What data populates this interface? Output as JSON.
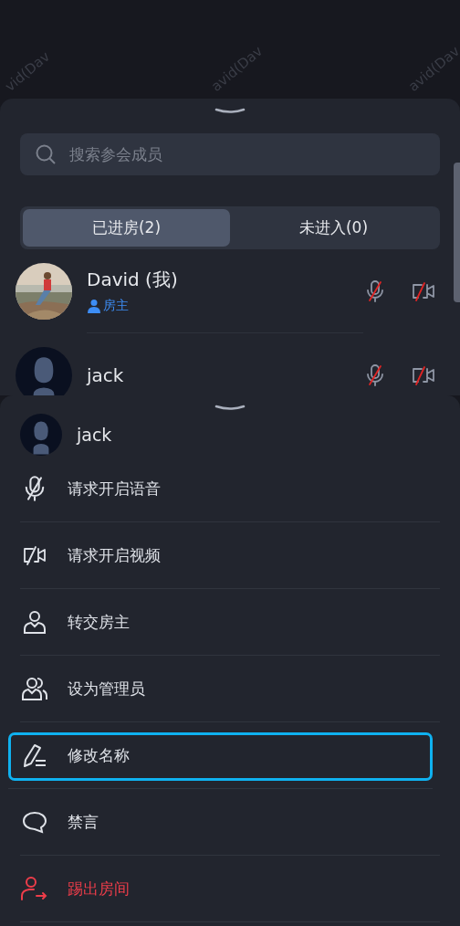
{
  "watermarks": [
    "vid(Dav",
    "avid(Dav",
    "avid(Dav"
  ],
  "member_panel": {
    "search": {
      "placeholder": "搜索参会成员"
    },
    "tabs": [
      {
        "label": "已进房(2)",
        "selected": true
      },
      {
        "label": "未进入(0)",
        "selected": false
      }
    ],
    "members": [
      {
        "name": "David (我)",
        "role": "房主",
        "mic_muted": true,
        "camera_off": true
      },
      {
        "name": "jack",
        "kind": "silhouette",
        "mic_muted": true,
        "camera_off": true
      }
    ]
  },
  "action_sheet": {
    "member": {
      "name": "jack"
    },
    "items": [
      {
        "kind": "mic",
        "label": "请求开启语音",
        "danger": false,
        "focused": false
      },
      {
        "kind": "camera",
        "label": "请求开启视频",
        "danger": false,
        "focused": false
      },
      {
        "kind": "host",
        "label": "转交房主",
        "danger": false,
        "focused": false
      },
      {
        "kind": "admin",
        "label": "设为管理员",
        "danger": false,
        "focused": false
      },
      {
        "kind": "rename",
        "label": "修改名称",
        "danger": false,
        "focused": true
      },
      {
        "kind": "mute",
        "label": "禁言",
        "danger": false,
        "focused": false
      },
      {
        "kind": "kick",
        "label": "踢出房间",
        "danger": true,
        "focused": false
      }
    ]
  }
}
